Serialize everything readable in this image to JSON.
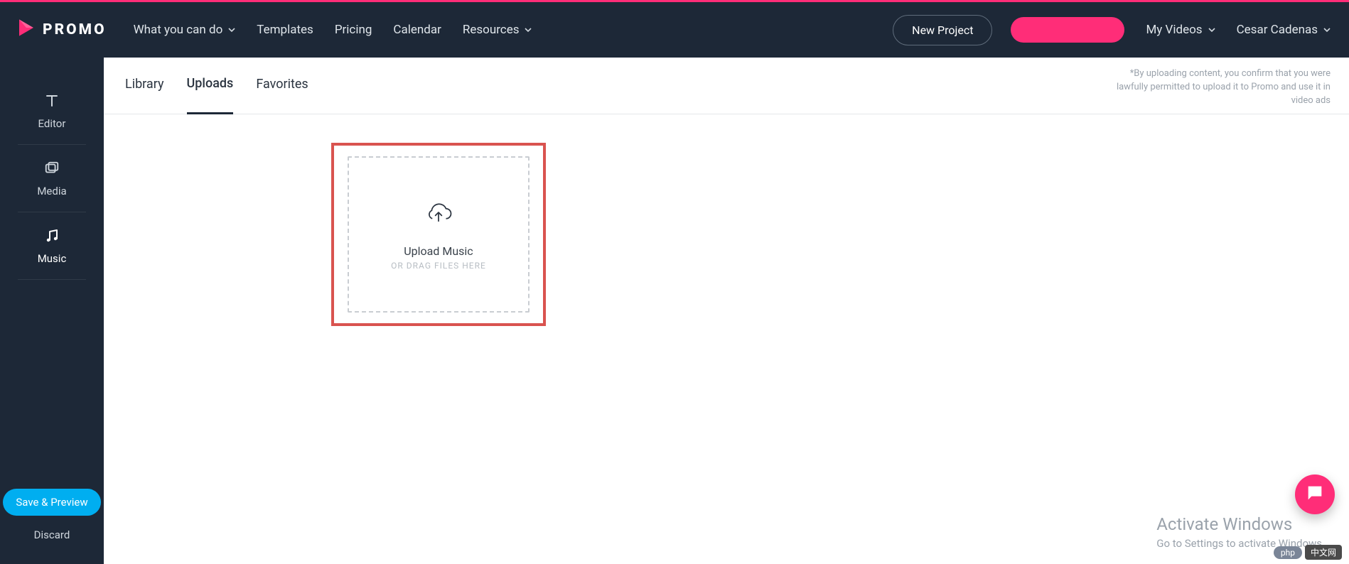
{
  "brand": {
    "name": "PROMO"
  },
  "nav": {
    "what": "What you can do",
    "templates": "Templates",
    "pricing": "Pricing",
    "calendar": "Calendar",
    "resources": "Resources"
  },
  "header_actions": {
    "new_project": "New Project",
    "my_videos": "My Videos",
    "user_name": "Cesar Cadenas"
  },
  "sidebar": {
    "editor": "Editor",
    "media": "Media",
    "music": "Music",
    "save_preview": "Save & Preview",
    "discard": "Discard"
  },
  "tabs": {
    "library": "Library",
    "uploads": "Uploads",
    "favorites": "Favorites",
    "active": "uploads"
  },
  "legal_note": "*By uploading content, you confirm that you were lawfully permitted to upload it to Promo and use it in video ads",
  "upload": {
    "title": "Upload Music",
    "subtitle": "OR DRAG FILES HERE"
  },
  "os_watermark": {
    "title": "Activate Windows",
    "subtitle": "Go to Settings to activate Windows."
  },
  "footer_badges": {
    "php": "php",
    "cn": "中文网"
  }
}
